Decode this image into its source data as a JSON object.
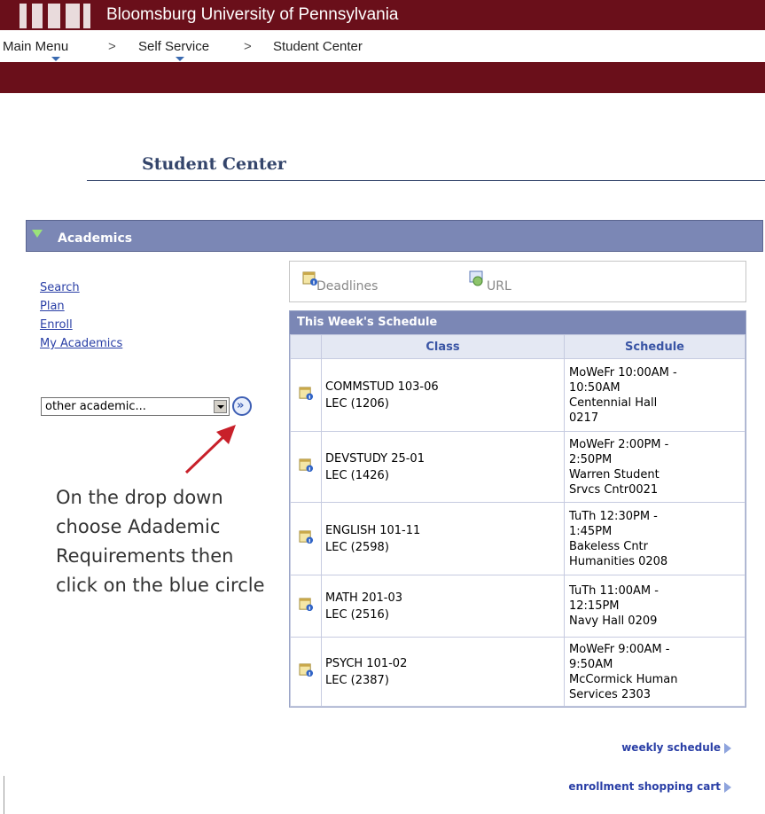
{
  "header": {
    "university": "Bloomsburg University of Pennsylvania",
    "brand_color": "#6a0f1a"
  },
  "breadcrumb": {
    "items": [
      "Main Menu",
      "Self Service",
      "Student Center"
    ],
    "separator": ">"
  },
  "page": {
    "title": "Student Center"
  },
  "academics": {
    "section_label": "Academics",
    "links": [
      "Search",
      "Plan",
      "Enroll",
      "My Academics"
    ],
    "dropdown": {
      "selected": "other academic..."
    },
    "go_button_glyph": "»",
    "instruction_note": "On the drop down choose Adademic Requirements then click on the blue circle"
  },
  "quick_links": {
    "deadlines": "Deadlines",
    "url": "URL"
  },
  "schedule": {
    "title": "This Week's Schedule",
    "columns": [
      "Class",
      "Schedule"
    ],
    "rows": [
      {
        "class_line1": "COMMSTUD 103-06",
        "class_line2": "LEC (1206)",
        "sched": [
          "MoWeFr 10:00AM -",
          "10:50AM",
          "Centennial Hall",
          "0217"
        ]
      },
      {
        "class_line1": "DEVSTUDY 25-01",
        "class_line2": "LEC (1426)",
        "sched": [
          "MoWeFr 2:00PM -",
          "2:50PM",
          "Warren Student",
          "Srvcs Cntr0021"
        ]
      },
      {
        "class_line1": "ENGLISH 101-11",
        "class_line2": "LEC (2598)",
        "sched": [
          "TuTh 12:30PM -",
          "1:45PM",
          "Bakeless Cntr",
          "Humanities 0208"
        ]
      },
      {
        "class_line1": "MATH 201-03",
        "class_line2": "LEC (2516)",
        "sched": [
          "TuTh 11:00AM -",
          "12:15PM",
          "Navy Hall 0209"
        ]
      },
      {
        "class_line1": "PSYCH 101-02",
        "class_line2": "LEC (2387)",
        "sched": [
          "MoWeFr 9:00AM -",
          "9:50AM",
          "McCormick Human",
          "Services 2303"
        ]
      }
    ]
  },
  "footer_links": {
    "weekly": "weekly schedule",
    "cart": "enrollment shopping cart"
  },
  "colors": {
    "section_header": "#7b87b5",
    "link": "#2a3fa6",
    "title": "#34456b",
    "annotation_arrow": "#c8202a"
  }
}
